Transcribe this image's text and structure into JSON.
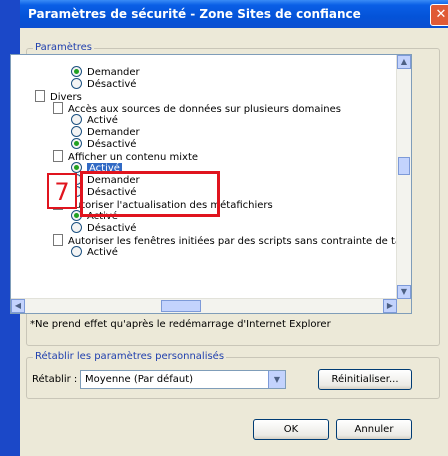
{
  "window": {
    "title": "Paramètres de sécurité - Zone Sites de confiance",
    "close_glyph": "✕"
  },
  "settings_group": {
    "legend": "Paramètres"
  },
  "tree": {
    "rows": [
      {
        "kind": "radio",
        "checked": true,
        "label": "Demander"
      },
      {
        "kind": "radio",
        "checked": false,
        "label": "Désactivé"
      },
      {
        "kind": "folder",
        "label": "Divers"
      },
      {
        "kind": "item",
        "label": "Accès aux sources de données sur plusieurs domaines"
      },
      {
        "kind": "radio",
        "checked": false,
        "label": "Activé"
      },
      {
        "kind": "radio",
        "checked": false,
        "label": "Demander"
      },
      {
        "kind": "radio",
        "checked": true,
        "label": "Désactivé"
      },
      {
        "kind": "item",
        "label": "Afficher un contenu mixte"
      },
      {
        "kind": "radio",
        "checked": true,
        "label": "Activé",
        "selected": true
      },
      {
        "kind": "radio",
        "checked": false,
        "label": "Demander"
      },
      {
        "kind": "radio",
        "checked": false,
        "label": "Désactivé"
      },
      {
        "kind": "item",
        "label": "Autoriser l'actualisation des métafichiers"
      },
      {
        "kind": "radio",
        "checked": true,
        "label": "Activé"
      },
      {
        "kind": "radio",
        "checked": false,
        "label": "Désactivé"
      },
      {
        "kind": "item",
        "label": "Autoriser les fenêtres initiées par des scripts sans contrainte de taille ou de position"
      },
      {
        "kind": "radio",
        "checked": false,
        "label": "Activé"
      }
    ]
  },
  "annotation": {
    "step_number": "7"
  },
  "note": "*Ne prend effet qu'après le redémarrage d'Internet Explorer",
  "reset_group": {
    "legend": "Rétablir les paramètres personnalisés",
    "label": "Rétablir :",
    "selected_option": "Moyenne (Par défaut)",
    "reset_button": "Réinitialiser..."
  },
  "footer": {
    "ok_button": "OK",
    "cancel_button": "Annuler"
  },
  "colors": {
    "titlebar": "#0453d8",
    "selection": "#316ac5",
    "annotation_red": "#e0141e",
    "radio_dot": "#21a121"
  }
}
